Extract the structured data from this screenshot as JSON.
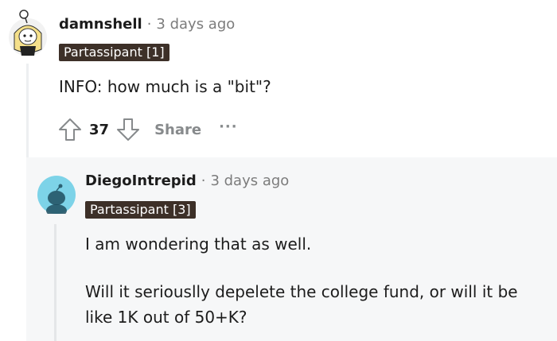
{
  "comment": {
    "username": "damnshell",
    "separator": "·",
    "time": "3 days ago",
    "flair": "Partassipant [1]",
    "body": "INFO: how much is a \"bit\"?",
    "score": "37",
    "share_label": "Share",
    "more_label": "···",
    "icons": {
      "avatar": "snoo-avatar-icon",
      "upvote": "upvote-arrow-icon",
      "downvote": "downvote-arrow-icon",
      "more": "more-options-icon"
    }
  },
  "reply": {
    "username": "DiegoIntrepid",
    "separator": "·",
    "time": "3 days ago",
    "flair": "Partassipant [3]",
    "paragraphs": [
      "I am wondering that as well.",
      "Will it seriouslly depelete the college fund, or will it be",
      "like 1K out of 50+K?"
    ],
    "icons": {
      "avatar": "default-snoo-avatar-icon"
    }
  },
  "colors": {
    "flair_bg": "#3d3028",
    "reply_bg": "#f6f7f8",
    "avatar_bg": "#7dd3e8",
    "thread_line": "#edeff1"
  }
}
